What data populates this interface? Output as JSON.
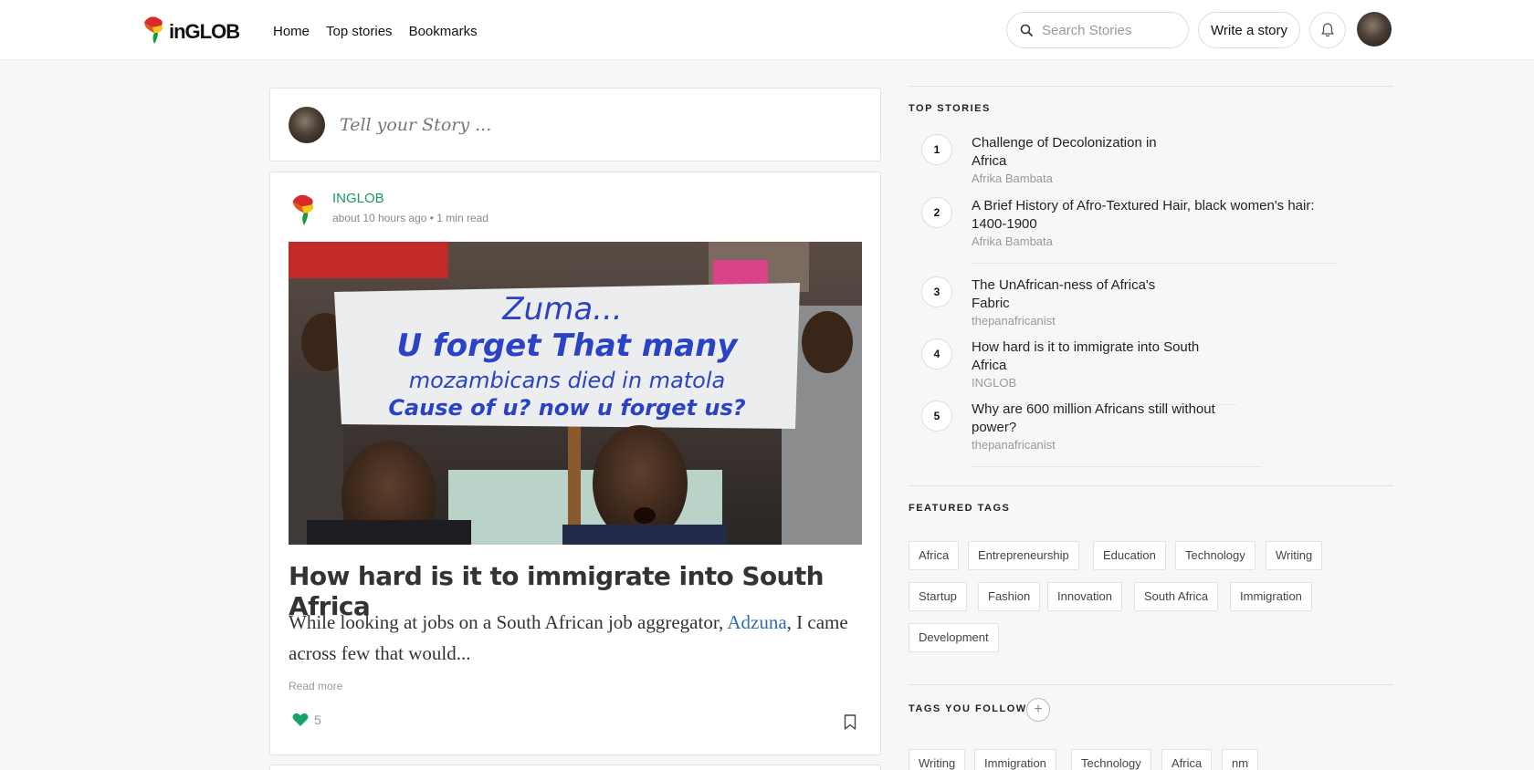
{
  "nav": {
    "brand": "inGLOB",
    "links": [
      "Home",
      "Top stories",
      "Bookmarks"
    ],
    "search_placeholder": "Search Stories",
    "write_label": "Write a story"
  },
  "compose": {
    "placeholder": "Tell your Story ..."
  },
  "story": {
    "author": "INGLOB",
    "meta": "about 10 hours ago • 1 min read",
    "title": "How hard is it to immigrate into South Africa",
    "excerpt_before": "While looking at jobs on a South African job aggregator, ",
    "excerpt_link": "Adzuna",
    "excerpt_after": ", I came across few that would...",
    "read_more": "Read more",
    "likes": "5",
    "sign_text": {
      "line1": "Zuma...",
      "line2": "U forget That many",
      "line3": "mozambicans died in matola",
      "line4": "Cause of u? now u forget us?"
    }
  },
  "sidebar": {
    "top_stories": {
      "title": "TOP STORIES",
      "items": [
        {
          "rank": "1",
          "title": "Challenge of Decolonization in Africa",
          "author": "Afrika Bambata"
        },
        {
          "rank": "2",
          "title": "A Brief History of Afro-Textured Hair, black women's hair: 1400-1900",
          "author": "Afrika Bambata"
        },
        {
          "rank": "3",
          "title": "The UnAfrican-ness of Africa's Fabric",
          "author": "thepanafricanist"
        },
        {
          "rank": "4",
          "title": "How hard is it to immigrate into South Africa",
          "author": "INGLOB"
        },
        {
          "rank": "5",
          "title": "Why are 600 million Africans still without power?",
          "author": "thepanafricanist"
        }
      ]
    },
    "featured_tags": {
      "title": "FEATURED TAGS",
      "tags": [
        "Africa",
        "Entrepreneurship",
        "Education",
        "Technology",
        "Writing",
        "Startup",
        "Fashion",
        "Innovation",
        "South Africa",
        "Immigration",
        "Development"
      ]
    },
    "tags_you_follow": {
      "title": "TAGS YOU FOLLOW",
      "add_label": "+",
      "tags": [
        "Writing",
        "Immigration",
        "Technology",
        "Africa",
        "nm"
      ]
    }
  },
  "colors": {
    "accent_green": "#1a9a5c",
    "link_blue": "#2f6fb0",
    "heart": "#16a36a"
  }
}
